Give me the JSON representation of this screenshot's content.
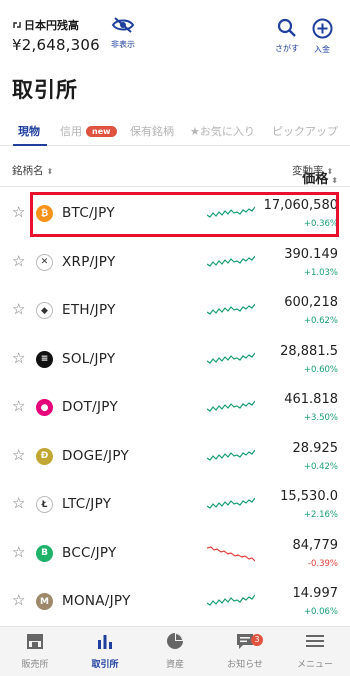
{
  "header": {
    "balance_label": "日本円残高",
    "balance_value": "¥2,648,306",
    "hide_label": "非表示",
    "search_label": "さがす",
    "deposit_label": "入金"
  },
  "page_title": "取引所",
  "tabs": [
    {
      "label": "現物",
      "active": true
    },
    {
      "label": "信用",
      "badge": "new"
    },
    {
      "label": "保有銘柄"
    },
    {
      "label": "★お気に入り"
    },
    {
      "label": "ピックアップ"
    }
  ],
  "sort": {
    "name": "銘柄名",
    "price": "価格",
    "change": "変動率",
    "arrow": "⬍"
  },
  "rows": [
    {
      "pair": "BTC/JPY",
      "price": "17,060,580",
      "change": "+0.36%",
      "dir": "up",
      "icon": "bitcoin-icon",
      "color": "#f7931a",
      "glyph": "₿"
    },
    {
      "pair": "XRP/JPY",
      "price": "390.149",
      "change": "+1.03%",
      "dir": "up",
      "icon": "xrp-icon",
      "color": "#ffffff",
      "glyph": "✕"
    },
    {
      "pair": "ETH/JPY",
      "price": "600,218",
      "change": "+0.62%",
      "dir": "up",
      "icon": "ethereum-icon",
      "color": "#ffffff",
      "glyph": "◆"
    },
    {
      "pair": "SOL/JPY",
      "price": "28,881.5",
      "change": "+0.60%",
      "dir": "up",
      "icon": "solana-icon",
      "color": "#111111",
      "glyph": "≡"
    },
    {
      "pair": "DOT/JPY",
      "price": "461.818",
      "change": "+3.50%",
      "dir": "up",
      "icon": "polkadot-icon",
      "color": "#e6007a",
      "glyph": "●"
    },
    {
      "pair": "DOGE/JPY",
      "price": "28.925",
      "change": "+0.42%",
      "dir": "up",
      "icon": "dogecoin-icon",
      "color": "#c2a633",
      "glyph": "Đ"
    },
    {
      "pair": "LTC/JPY",
      "price": "15,530.0",
      "change": "+2.16%",
      "dir": "up",
      "icon": "litecoin-icon",
      "color": "#ffffff",
      "glyph": "Ł"
    },
    {
      "pair": "BCC/JPY",
      "price": "84,779",
      "change": "-0.39%",
      "dir": "down",
      "icon": "bitcoin-cash-icon",
      "color": "#1fb36a",
      "glyph": "B"
    },
    {
      "pair": "MONA/JPY",
      "price": "14.997",
      "change": "+0.06%",
      "dir": "up",
      "icon": "monacoin-icon",
      "color": "#9e8a6a",
      "glyph": "M"
    }
  ],
  "bottom_nav": [
    {
      "label": "販売所",
      "icon": "shop-icon"
    },
    {
      "label": "取引所",
      "icon": "exchange-chart-icon",
      "active": true
    },
    {
      "label": "資産",
      "icon": "pie-chart-icon"
    },
    {
      "label": "お知らせ",
      "icon": "notification-icon",
      "badge": "3"
    },
    {
      "label": "メニュー",
      "icon": "menu-icon"
    }
  ],
  "colors": {
    "accent": "#1e3f9e",
    "up": "#1a9e72",
    "down": "#e0403a",
    "highlight": "#e8102d"
  }
}
